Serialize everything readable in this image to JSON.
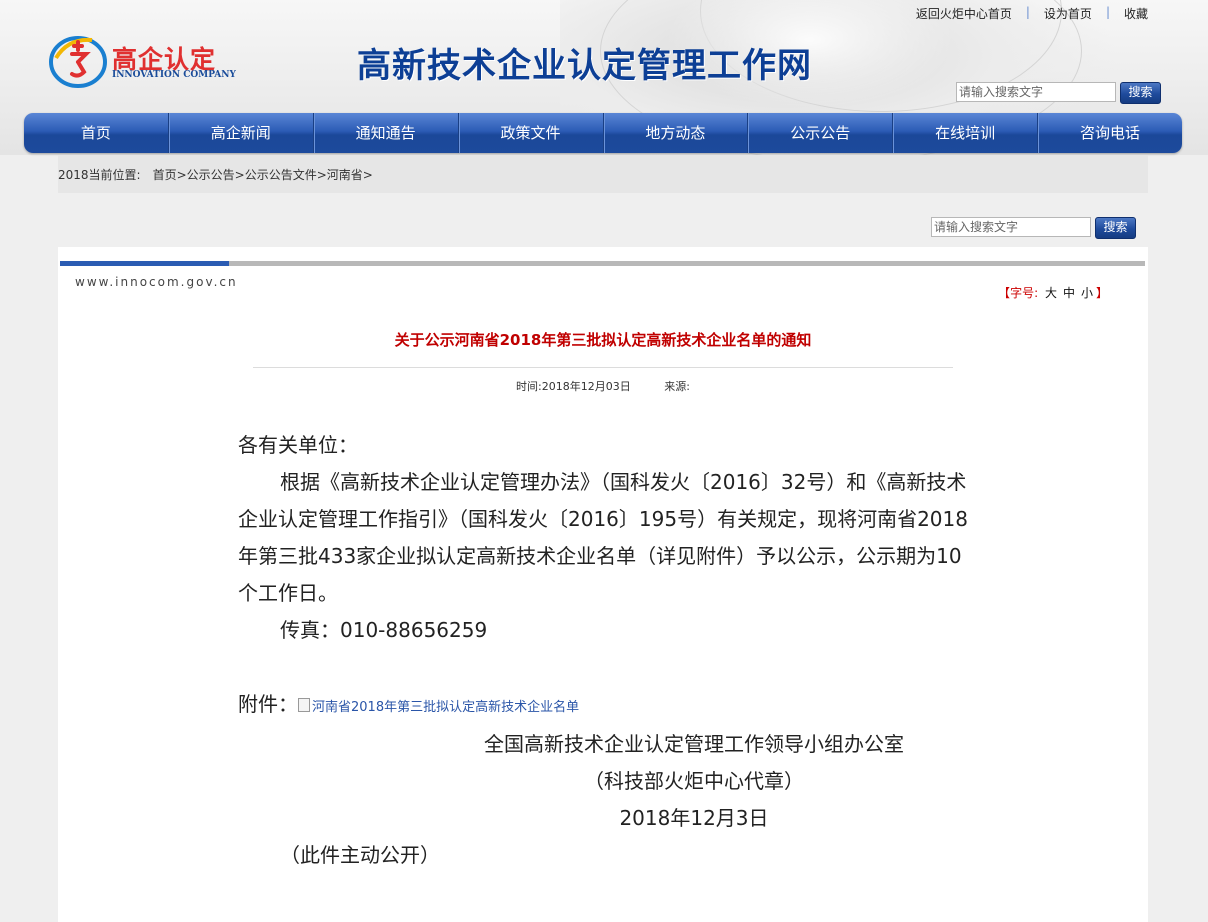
{
  "header": {
    "top_links": [
      "返回火炬中心首页",
      "设为首页",
      "收藏"
    ],
    "logo_cn": "高企认定",
    "logo_en": "INNOVATION COMPANY",
    "site_title": "高新技术企业认定管理工作网",
    "search_placeholder": "请输入搜索文字",
    "search_button": "搜索"
  },
  "nav": [
    "首页",
    "高企新闻",
    "通知通告",
    "政策文件",
    "地方动态",
    "公示公告",
    "在线培训",
    "咨询电话"
  ],
  "breadcrumb": {
    "prefix": "2018当前位置:",
    "path": "首页>公示公告>公示公告文件>河南省>"
  },
  "search2": {
    "placeholder": "请输入搜索文字",
    "button": "搜索"
  },
  "article": {
    "domain": "www.innocom.gov.cn",
    "font_size_label": "字号:",
    "font_size_options": [
      "大",
      "中",
      "小"
    ],
    "title": "关于公示河南省2018年第三批拟认定高新技术企业名单的通知",
    "time_label": "时间:",
    "time_value": "2018年12月03日",
    "source_label": "来源:",
    "salutation": "各有关单位：",
    "paragraph": "根据《高新技术企业认定管理办法》（国科发火〔2016〕32号）和《高新技术企业认定管理工作指引》（国科发火〔2016〕195号）有关规定，现将河南省2018年第三批433家企业拟认定高新技术企业名单（详见附件）予以公示，公示期为10个工作日。",
    "fax": "传真：010-88656259",
    "attachment_label": "附件：",
    "attachment_link": "河南省2018年第三批拟认定高新技术企业名单",
    "signature_org": "全国高新技术企业认定管理工作领导小组办公室",
    "signature_sub": "（科技部火炬中心代章）",
    "signature_date": "2018年12月3日",
    "note": "（此件主动公开）"
  },
  "colors": {
    "nav_blue": "#1f4b9c",
    "title_red": "#c00000",
    "site_title_blue": "#0d3f95",
    "logo_red": "#e03030"
  }
}
